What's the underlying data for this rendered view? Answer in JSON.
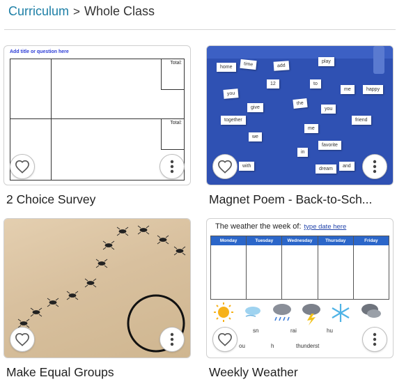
{
  "breadcrumb": {
    "root": "Curriculum",
    "separator": ">",
    "current": "Whole Class"
  },
  "colors": {
    "link": "#1d7fa6",
    "magnet_board": "#2f51b3",
    "weather_header": "#2b66c9",
    "survey_title": "#2b3bd6"
  },
  "cards": [
    {
      "title": "2 Choice Survey",
      "thumbnail": {
        "title": "Add title or question here",
        "totals": [
          "Total:",
          "Total:"
        ]
      }
    },
    {
      "title": "Magnet Poem - Back-to-Sch...",
      "thumbnail": {
        "words": [
          "home",
          "time",
          "add",
          "play",
          "12",
          "to",
          "me",
          "happy",
          "you",
          "give",
          "the",
          "you",
          "together",
          "me",
          "friend",
          "we",
          "favorite",
          "with",
          "in",
          "dream",
          "and"
        ]
      }
    },
    {
      "title": "Make Equal Groups",
      "thumbnail": {}
    },
    {
      "title": "Weekly Weather",
      "thumbnail": {
        "heading": "The weather the week of:",
        "date_link": "type date here",
        "days": [
          "Monday",
          "Tuesday",
          "Wednesday",
          "Thursday",
          "Friday"
        ],
        "icons": [
          "sun-icon",
          "windy-icon",
          "rain-cloud-icon",
          "storm-cloud-icon",
          "snowflake-icon",
          "cloud-icon"
        ],
        "word_fragments": [
          "sn",
          "rai",
          "hu",
          "ou",
          "h",
          "thunderst"
        ]
      }
    }
  ]
}
